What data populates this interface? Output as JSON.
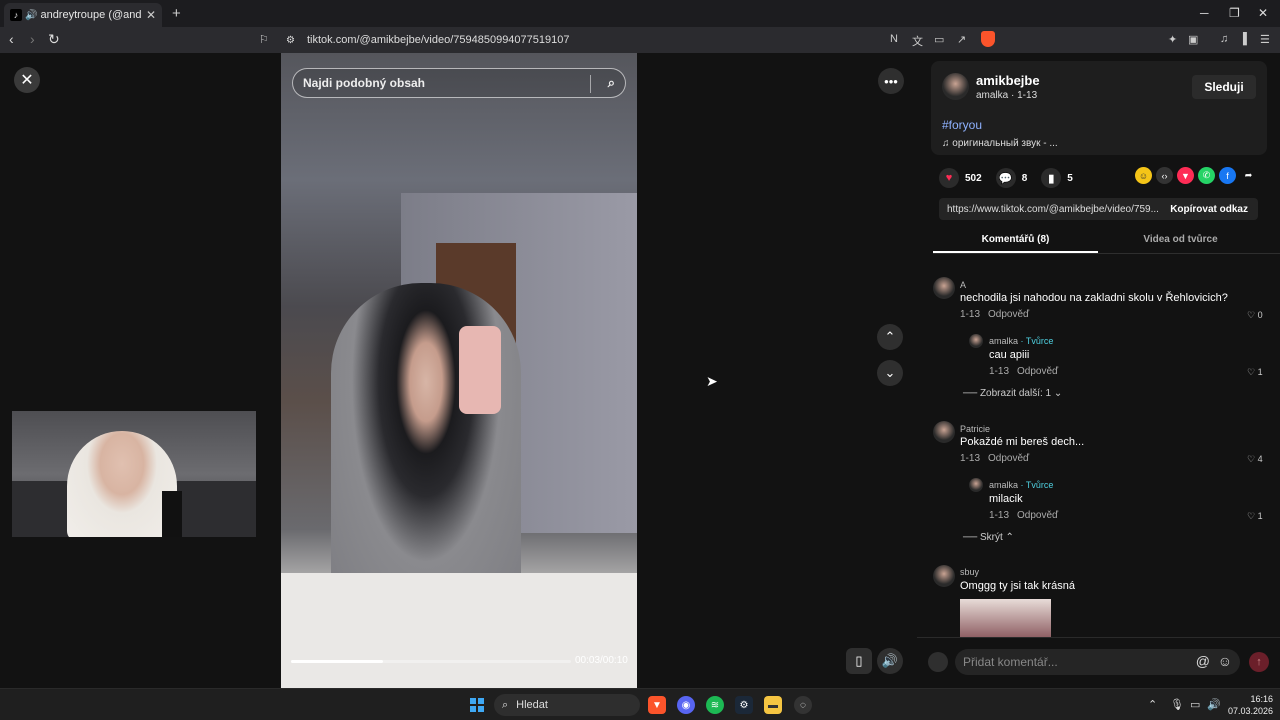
{
  "browser": {
    "tab_title": "andreytroupe (@andreytroupe",
    "address": "tiktok.com/@amikbejbe/video/7594850994077519107"
  },
  "video": {
    "search_placeholder": "Najdi podobný obsah",
    "progress_fraction": 0.33,
    "timecode": "00:03/00:10"
  },
  "author": {
    "name": "amikbejbe",
    "meta": "amalka · 1-13",
    "follow_label": "Sleduji",
    "hashtag": "#foryou",
    "sound": "оригинальный звук - ..."
  },
  "stats": {
    "likes": "502",
    "comments": "8",
    "saves": "5"
  },
  "share": {
    "url": "https://www.tiktok.com/@amikbejbe/video/759...",
    "copy_label": "Kopírovat odkaz",
    "colors": [
      "#f5c518",
      "#333333",
      "#fe2c55",
      "#25d366",
      "#1877f2",
      "#121212"
    ]
  },
  "panel_tabs": [
    "Komentářů (8)",
    "Videa od tvůrce"
  ],
  "comments": [
    {
      "name": "A",
      "text": "nechodila jsi nahodou na zakladni skolu v Řehlovicich?",
      "date": "1-13",
      "reply": "Odpověď",
      "likes": "0"
    },
    {
      "name": "amalka",
      "creator": "· Tvůrce",
      "text": "cau apiii",
      "date": "1-13",
      "reply": "Odpověď",
      "likes": "1"
    },
    {
      "more": "Zobrazit další: 1"
    },
    {
      "name": "Patricie",
      "text": "Pokaždé mi bereš dech...",
      "date": "1-13",
      "reply": "Odpověď",
      "likes": "4"
    },
    {
      "name": "amalka",
      "creator": "· Tvůrce",
      "text": "milacik",
      "date": "1-13",
      "reply": "Odpověď",
      "likes": "1"
    },
    {
      "more": "Skrýt"
    },
    {
      "name": "sbuy",
      "text": "Omggg ty jsi tak krásná"
    }
  ],
  "comment_input": {
    "placeholder": "Přidat komentář..."
  },
  "taskbar": {
    "search": "Hledat",
    "time": "16:16",
    "date": "07.03.2026"
  }
}
